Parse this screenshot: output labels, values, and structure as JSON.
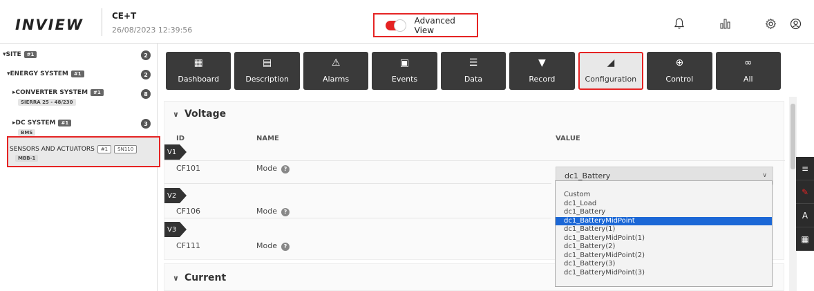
{
  "header": {
    "logo": "INVIEW",
    "site_name": "CE+T",
    "datetime": "26/08/2023 12:39:56",
    "advanced_view_label": "Advanced View",
    "advanced_view_on": true,
    "icons": [
      "bell-icon",
      "chart-bars-icon",
      "gear-icon",
      "user-icon"
    ]
  },
  "sidebar": {
    "site": {
      "label": "SITE",
      "badge": "#1",
      "count": "2"
    },
    "energy_system": {
      "label": "ENERGY SYSTEM",
      "badge": "#1",
      "count": "2"
    },
    "converter_system": {
      "label": "CONVERTER SYSTEM",
      "badge": "#1",
      "count": "8",
      "sub": "SIERRA 25 - 48/230"
    },
    "dc_system": {
      "label": "DC SYSTEM",
      "badge": "#1",
      "count": "3",
      "sub": "BMS"
    },
    "sensors": {
      "label": "SENSORS AND ACTUATORS",
      "badge": "#1",
      "badge2": "SN110",
      "sub": "MBB-1"
    }
  },
  "toolbar": [
    {
      "label": "Dashboard",
      "icon": "dashboard-icon"
    },
    {
      "label": "Description",
      "icon": "document-icon"
    },
    {
      "label": "Alarms",
      "icon": "alarm-icon"
    },
    {
      "label": "Events",
      "icon": "calendar-icon"
    },
    {
      "label": "Data",
      "icon": "data-icon"
    },
    {
      "label": "Record",
      "icon": "record-icon"
    },
    {
      "label": "Configuration",
      "icon": "configuration-icon",
      "active": true
    },
    {
      "label": "Control",
      "icon": "control-icon"
    },
    {
      "label": "All",
      "icon": "infinity-icon"
    }
  ],
  "voltage": {
    "title": "Voltage",
    "col_id": "ID",
    "col_name": "NAME",
    "col_value": "VALUE",
    "tags": [
      "V1",
      "V2",
      "V3"
    ],
    "rows": [
      {
        "id": "CF101",
        "name": "Mode"
      },
      {
        "id": "CF106",
        "name": "Mode"
      },
      {
        "id": "CF111",
        "name": "Mode"
      }
    ],
    "selected_value": "dc1_Battery",
    "options": [
      "Custom",
      "dc1_Load",
      "dc1_Battery",
      "dc1_BatteryMidPoint",
      "dc1_Battery(1)",
      "dc1_BatteryMidPoint(1)",
      "dc1_Battery(2)",
      "dc1_BatteryMidPoint(2)",
      "dc1_Battery(3)",
      "dc1_BatteryMidPoint(3)"
    ],
    "highlighted_option": "dc1_BatteryMidPoint"
  },
  "current": {
    "title": "Current"
  },
  "float_tools": [
    "filter-icon",
    "pencil-icon",
    "spellcheck-icon",
    "grid-icon"
  ],
  "colors": {
    "accent_red": "#e52323",
    "dark_button": "#3a3a3a",
    "highlight_blue": "#1b67d6"
  }
}
